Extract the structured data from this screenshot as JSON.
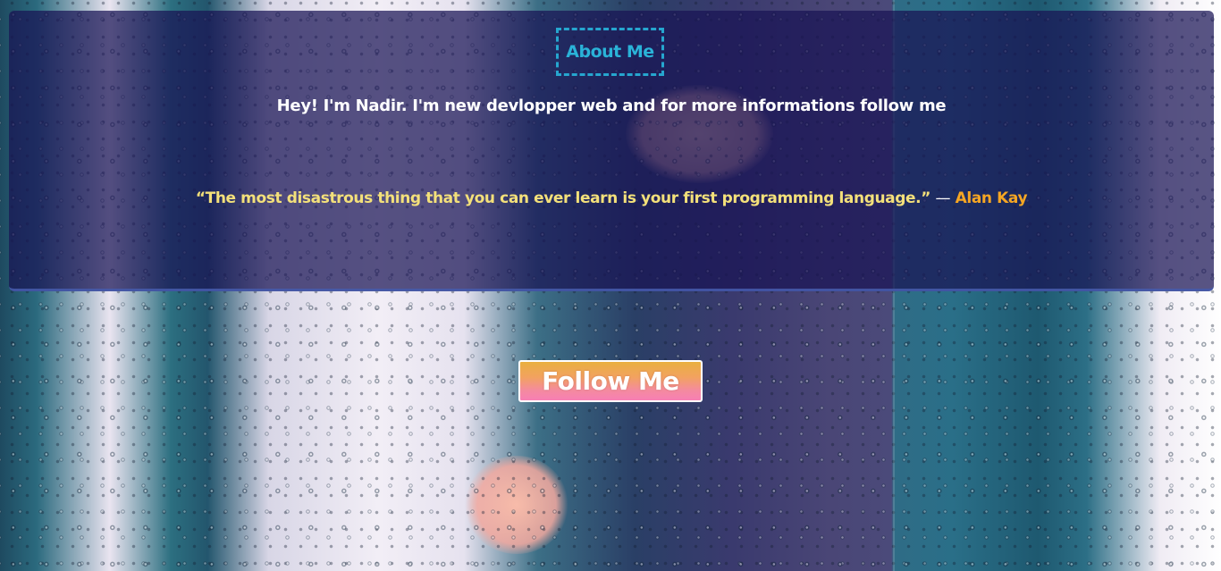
{
  "about": {
    "title": "About Me",
    "intro": "Hey! I'm Nadir. I'm new devlopper web and for more informations follow me",
    "quote": {
      "text": "“The most disastrous thing that you can ever learn is your first programming language.”",
      "dash": "—",
      "author": "Alan Kay"
    }
  },
  "follow_button": {
    "label": "Follow Me"
  },
  "colors": {
    "panel_background": "#191455",
    "title_accent": "#2ab3d8",
    "quote_text": "#f3e07a",
    "quote_author": "#f5a623",
    "button_gradient_top": "#e9b040",
    "button_gradient_bottom": "#f77fb4"
  }
}
